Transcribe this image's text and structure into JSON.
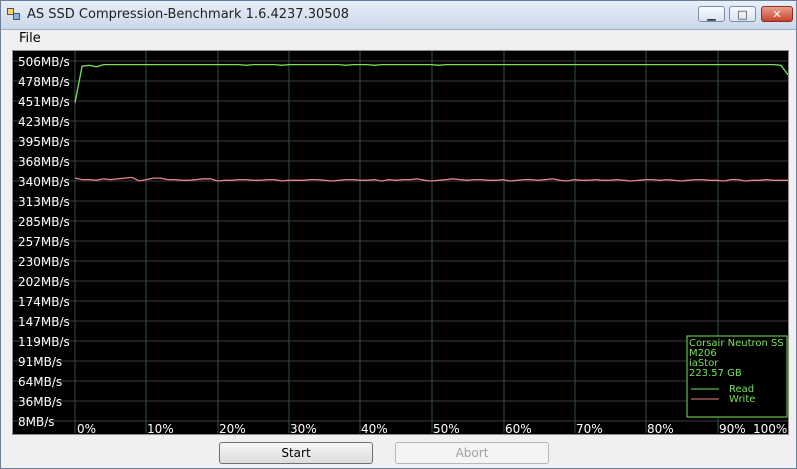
{
  "window": {
    "title": "AS SSD Compression-Benchmark 1.6.4237.30508"
  },
  "menu": {
    "file": "File"
  },
  "chart_data": {
    "type": "line",
    "ylabels": [
      "506MB/s",
      "478MB/s",
      "451MB/s",
      "423MB/s",
      "395MB/s",
      "368MB/s",
      "340MB/s",
      "313MB/s",
      "285MB/s",
      "257MB/s",
      "230MB/s",
      "202MB/s",
      "174MB/s",
      "147MB/s",
      "119MB/s",
      "91MB/s",
      "64MB/s",
      "36MB/s",
      "8MB/s"
    ],
    "xlabels": [
      "0%",
      "10%",
      "20%",
      "30%",
      "40%",
      "50%",
      "60%",
      "70%",
      "80%",
      "90%",
      "100%"
    ],
    "x": [
      0,
      1,
      2,
      3,
      4,
      5,
      6,
      7,
      8,
      9,
      10,
      11,
      12,
      13,
      14,
      15,
      16,
      17,
      18,
      19,
      20,
      21,
      22,
      23,
      24,
      25,
      26,
      27,
      28,
      29,
      30,
      31,
      32,
      33,
      34,
      35,
      36,
      37,
      38,
      39,
      40,
      41,
      42,
      43,
      44,
      45,
      46,
      47,
      48,
      49,
      50,
      51,
      52,
      53,
      54,
      55,
      56,
      57,
      58,
      59,
      60,
      61,
      62,
      63,
      64,
      65,
      66,
      67,
      68,
      69,
      70,
      71,
      72,
      73,
      74,
      75,
      76,
      77,
      78,
      79,
      80,
      81,
      82,
      83,
      84,
      85,
      86,
      87,
      88,
      89,
      90,
      91,
      92,
      93,
      94,
      95,
      96,
      97,
      98,
      99,
      100
    ],
    "ylim": [
      8,
      506
    ],
    "series": [
      {
        "name": "Read",
        "color": "#7be05b",
        "values": [
          448,
          499,
          500,
          498,
          501,
          501,
          501,
          501,
          501,
          501,
          501,
          501,
          501,
          501,
          501,
          501,
          501,
          501,
          501,
          501,
          501,
          501,
          501,
          501,
          500,
          501,
          501,
          501,
          501,
          500,
          501,
          501,
          501,
          501,
          501,
          501,
          501,
          501,
          500,
          501,
          501,
          501,
          500,
          501,
          501,
          501,
          501,
          501,
          501,
          501,
          501,
          500,
          501,
          501,
          501,
          501,
          501,
          501,
          501,
          501,
          501,
          501,
          501,
          501,
          501,
          501,
          501,
          501,
          501,
          501,
          501,
          501,
          501,
          501,
          501,
          501,
          501,
          501,
          501,
          501,
          501,
          501,
          501,
          501,
          501,
          501,
          501,
          501,
          501,
          501,
          501,
          501,
          501,
          501,
          501,
          501,
          501,
          501,
          501,
          500,
          487
        ]
      },
      {
        "name": "Write",
        "color": "#e88585",
        "values": [
          344,
          342,
          342,
          341,
          343,
          342,
          343,
          344,
          345,
          340,
          342,
          344,
          344,
          342,
          342,
          341,
          341,
          342,
          343,
          343,
          340,
          341,
          341,
          342,
          342,
          341,
          341,
          342,
          342,
          340,
          341,
          341,
          341,
          342,
          342,
          341,
          340,
          341,
          342,
          342,
          341,
          341,
          342,
          340,
          342,
          341,
          342,
          342,
          343,
          341,
          340,
          341,
          342,
          343,
          342,
          341,
          342,
          342,
          341,
          341,
          342,
          340,
          341,
          342,
          342,
          341,
          342,
          343,
          341,
          340,
          342,
          341,
          341,
          342,
          341,
          341,
          342,
          341,
          340,
          341,
          342,
          342,
          341,
          342,
          341,
          340,
          341,
          342,
          342,
          341,
          341,
          340,
          342,
          342,
          340,
          341,
          341,
          342,
          341,
          341,
          341
        ]
      }
    ]
  },
  "legend": {
    "drive_name": "Corsair Neutron SS",
    "firmware": "M206",
    "driver": "iaStor",
    "capacity": "223.57 GB",
    "read_label": "Read",
    "write_label": "Write"
  },
  "buttons": {
    "start": "Start",
    "abort": "Abort"
  }
}
